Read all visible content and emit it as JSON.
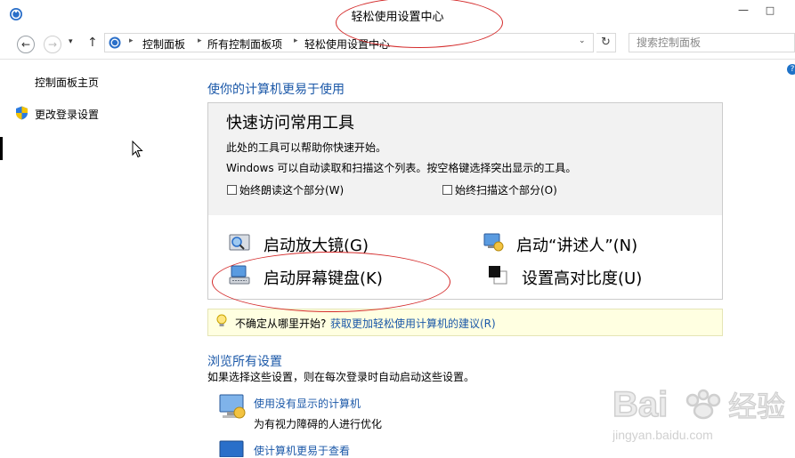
{
  "window": {
    "title": "轻松使用设置中心",
    "minimize": "—",
    "maximize": "□"
  },
  "nav": {
    "back": "←",
    "forward": "→",
    "recent": "▾",
    "up": "↑",
    "crumbs": [
      "控制面板",
      "所有控制面板项",
      "轻松使用设置中心"
    ],
    "sep": "▸",
    "dropdown": "⌄",
    "refresh": "↻",
    "search_placeholder": "搜索控制面板",
    "help": "?"
  },
  "left": {
    "home": "控制面板主页",
    "change_login": "更改登录设置"
  },
  "main": {
    "heading": "使你的计算机更易于使用",
    "quick": {
      "title": "快速访问常用工具",
      "desc1": "此处的工具可以帮助你快速开始。",
      "desc2": "Windows 可以自动读取和扫描这个列表。按空格键选择突出显示的工具。",
      "check_read": "始终朗读这个部分(W)",
      "check_scan": "始终扫描这个部分(O)",
      "tools": {
        "magnifier": "启动放大镜(G)",
        "narrator": "启动“讲述人”(N)",
        "osk": "启动屏幕键盘(K)",
        "contrast": "设置高对比度(U)"
      }
    },
    "tip": {
      "text": "不确定从哪里开始?",
      "link": "获取更加轻松使用计算机的建议(R)"
    },
    "browse": {
      "heading": "浏览所有设置",
      "desc": "如果选择这些设置，则在每次登录时自动启动这些设置。",
      "items": [
        {
          "link": "使用没有显示的计算机",
          "desc": "为有视力障碍的人进行优化"
        },
        {
          "link": "使计算机更易于查看",
          "desc": ""
        }
      ]
    }
  },
  "watermark": {
    "brand": "Bai",
    "brand2": "经验",
    "url": "jingyan.baidu.com"
  },
  "colors": {
    "link": "#1b58a8",
    "annotation": "#d42a2a",
    "tip_bg": "#ffffe1"
  }
}
